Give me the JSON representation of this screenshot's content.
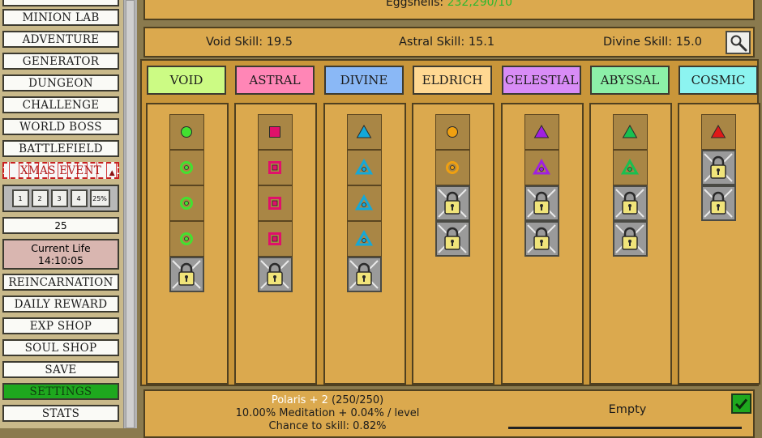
{
  "sidebar": {
    "top_partial_label": "MINION LAB",
    "items": [
      "ADVENTURE",
      "GENERATOR",
      "DUNGEON",
      "CHALLENGE",
      "WORLD BOSS",
      "BATTLEFIELD",
      "XMAS EVENT"
    ],
    "speed_buttons": [
      "1",
      "2",
      "3",
      "4",
      "25%"
    ],
    "amount": "25",
    "life_label": "Current Life",
    "life_time": "14:10:05",
    "bottom_items": [
      "REINCARNATION",
      "DAILY REWARD",
      "EXP SHOP",
      "SOUL SHOP",
      "SAVE",
      "SETTINGS",
      "STATS"
    ],
    "active_item": "SETTINGS"
  },
  "eggshells": {
    "label": "Eggshells:",
    "value": "232,290/10"
  },
  "skills": [
    {
      "label": "Void Skill: 19.5"
    },
    {
      "label": "Astral Skill: 15.1"
    },
    {
      "label": "Divine Skill: 15.0"
    }
  ],
  "columns": [
    {
      "label": "VOID",
      "color": "#ccfb84",
      "symbol_color": "#44e030",
      "shape": "circle",
      "unlocked": 4,
      "locked": 1
    },
    {
      "label": "ASTRAL",
      "color": "#ff86b6",
      "symbol_color": "#e0106a",
      "shape": "square",
      "unlocked": 4,
      "locked": 1
    },
    {
      "label": "DIVINE",
      "color": "#8ab8f6",
      "symbol_color": "#14a8d8",
      "shape": "triangle",
      "unlocked": 4,
      "locked": 1
    },
    {
      "label": "ELDRICH",
      "color": "#ffd892",
      "symbol_color": "#f0a010",
      "shape": "circle",
      "unlocked": 2,
      "locked": 2
    },
    {
      "label": "CELESTIAL",
      "color": "#d88cf6",
      "symbol_color": "#a020e0",
      "shape": "triangle",
      "unlocked": 2,
      "locked": 2
    },
    {
      "label": "ABYSSAL",
      "color": "#8cf0a8",
      "symbol_color": "#18c050",
      "shape": "triangle",
      "unlocked": 2,
      "locked": 2
    },
    {
      "label": "COSMIC",
      "color": "#8cf4f0",
      "symbol_color": "#e01818",
      "shape": "triangle",
      "unlocked": 1,
      "locked": 2
    }
  ],
  "selected": {
    "name": "Polaris + 2",
    "level": "(250/250)",
    "effect": "10.00% Meditation + 0.04% / level",
    "chance": "Chance to skill: 0.82%"
  },
  "slot": {
    "label": "Empty"
  },
  "icons": {
    "search": "magnifier-icon",
    "confirm": "check-icon",
    "lock": "lock-icon"
  }
}
